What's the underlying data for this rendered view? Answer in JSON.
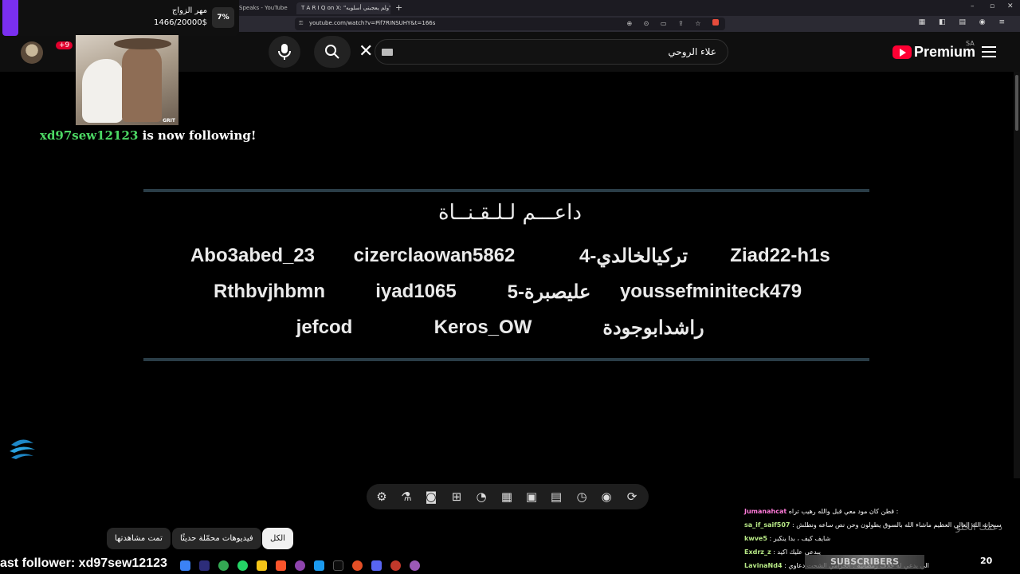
{
  "browser": {
    "tabs": [
      {
        "title": "Speaks - YouTube",
        "active": false
      },
      {
        "title": "T A R I Q on X: \"ولم يعجبني أسلوبه\"",
        "active": true
      }
    ],
    "url": "youtube.com/watch?v=Pif7RINSUHY&t=166s"
  },
  "youtube": {
    "logo_text": "Premium",
    "region": "SA",
    "search_value": "علاء الروحي",
    "notifications_badge": "+9"
  },
  "overlay": {
    "goal_title": "مهر الزواج",
    "goal_count": "1466/20000$",
    "goal_percent": "7%",
    "gif_tag": "GRIT",
    "follow_user": "xd97sew12123",
    "follow_text": " is now following!",
    "last_follower": "ast follower: xd97sew12123"
  },
  "video": {
    "title": "داعـــم لـلـقـنــاة",
    "supporters": [
      [
        "Abo3abed_23",
        "cizerclaowan5862",
        "تركيالخالدي-4",
        "Ziad22-h1s"
      ],
      [
        "Rthbvjhbmn",
        "iyad1065",
        "عليصبرة-5",
        "youssefminiteck479"
      ],
      [
        "jefcod",
        "Keros_OW",
        "راشدابوجودة"
      ]
    ]
  },
  "toolbar_icons": [
    "gear-icon",
    "flask-icon",
    "camera-icon",
    "add-frame-icon",
    "speed-icon",
    "grid-icon",
    "picture-in-picture-icon",
    "clapper-icon",
    "timer-icon",
    "broadcast-icon",
    "loop-icon"
  ],
  "chips": [
    {
      "label": "الكل",
      "selected": true
    },
    {
      "label": "فيديوهات محمّلة حديثًا",
      "selected": false
    },
    {
      "label": "تمت مشاهدتها",
      "selected": false
    }
  ],
  "chat": {
    "messages": [
      {
        "user": "Jumanahcat",
        "text": "قطن كان مود معي قبل والله رهيب تراه :",
        "user_color": "pink"
      },
      {
        "user": "sa_if_saif507",
        "text": ": سبحانه الله العالي العظيم ماشاء الله بالسوق يطولون وحن نص ساعه ونطلش",
        "user_color": "green"
      },
      {
        "user": "kwve5",
        "text": ": شايف كيف ، بدا ينكبر",
        "user_color": "green"
      },
      {
        "user": "Exdrz_z",
        "text": ": يبدعي عليك اكيد",
        "user_color": "green"
      },
      {
        "user": "LavinaNd4",
        "text": ": الي يدعي له خلاف رمضانيه : الحرامي الشحت دعاوي",
        "user_color": "green"
      }
    ],
    "side_text": "دعمك الحلو",
    "sub_label": "SUBSCRIBERS",
    "count": "20"
  }
}
